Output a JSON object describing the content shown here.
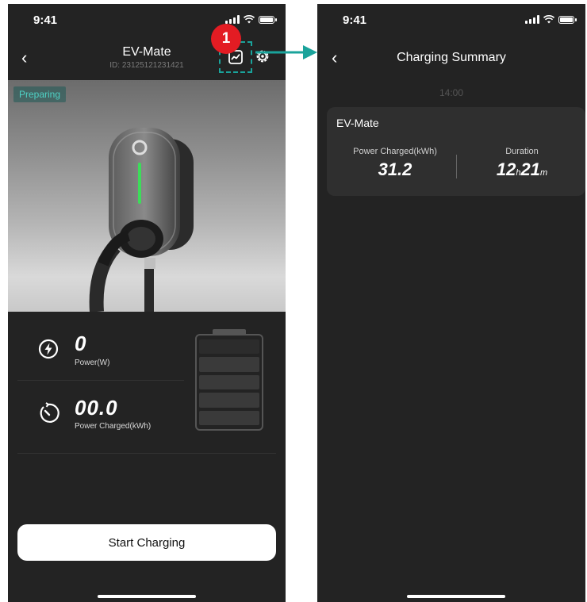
{
  "left_screen": {
    "status_time": "9:41",
    "title": "EV-Mate",
    "device_id": "ID: 23125121231421",
    "callout_number": "1",
    "status_badge": "Preparing",
    "power_value": "0",
    "power_label": "Power(W)",
    "energy_value": "00.0",
    "energy_label": "Power Charged(kWh)",
    "start_button_label": "Start  Charging"
  },
  "right_screen": {
    "status_time": "9:41",
    "title": "Charging Summary",
    "session_time": "14:00",
    "card": {
      "title": "EV-Mate",
      "power_label": "Power Charged(kWh)",
      "power_value": "31.2",
      "duration_label": "Duration",
      "duration_hours": "12",
      "duration_hours_unit": "h",
      "duration_minutes": "21",
      "duration_minutes_unit": "m"
    }
  },
  "colors": {
    "background": "#232323",
    "accent": "#1aa39b",
    "callout": "#e31c23",
    "charge_led": "#3ddc5a"
  },
  "icons": [
    "back-chevron-icon",
    "chart-icon",
    "gear-icon",
    "lightning-icon",
    "timer-icon",
    "battery-icon",
    "signal-icon",
    "wifi-icon",
    "arrow-right-icon"
  ]
}
